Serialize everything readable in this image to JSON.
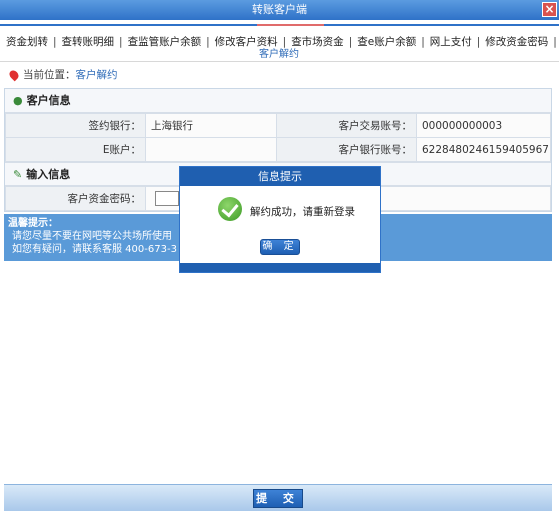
{
  "window": {
    "title": "转账客户端",
    "close_label": "×"
  },
  "nav": {
    "items": [
      "资金划转",
      "查转账明细",
      "查监管账户余额",
      "修改客户资料",
      "查市场资金",
      "查e账户余额",
      "网上支付",
      "修改资金密码"
    ],
    "separator": "|",
    "active_subtitle": "客户解约"
  },
  "location": {
    "label": "当前位置：",
    "value": "客户解约"
  },
  "customer_info": {
    "title": "客户信息",
    "rows": [
      {
        "l1": "签约银行：",
        "v1": "上海银行",
        "l2": "客户交易账号：",
        "v2": "000000000003"
      },
      {
        "l1": "E账户：",
        "v1": "",
        "l2": "客户银行账号：",
        "v2": "6228480246159405967"
      }
    ]
  },
  "input_info": {
    "title": "输入信息",
    "password_label": "客户资金密码："
  },
  "tips": {
    "title": "温馨提示：",
    "line1": "请您尽量不要在网吧等公共场所使用",
    "line2": "如您有疑问，请联系客服 400-673-3"
  },
  "dialog": {
    "title": "信息提示",
    "message": "解约成功，请重新登录",
    "confirm_label": "确 定"
  },
  "submit": {
    "label": "提 交"
  },
  "colors": {
    "primary": "#1f5fb0",
    "accent": "#5a9ad8",
    "success": "#3c9a25"
  }
}
